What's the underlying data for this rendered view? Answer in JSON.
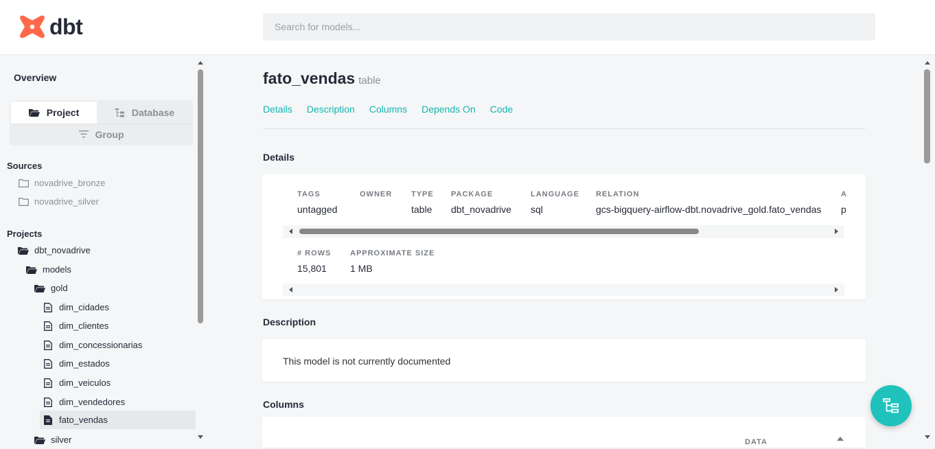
{
  "app": {
    "logo_text": "dbt",
    "brand_color": "#ff694a",
    "accent_color": "#13b5b0"
  },
  "search": {
    "placeholder": "Search for models..."
  },
  "sidebar": {
    "overview_label": "Overview",
    "toggle": {
      "project_label": "Project",
      "database_label": "Database",
      "group_label": "Group",
      "active": "Project"
    },
    "sources_title": "Sources",
    "sources": [
      "novadrive_bronze",
      "novadrive_silver"
    ],
    "projects_title": "Projects",
    "project_tree": {
      "project": "dbt_novadrive",
      "models_folder": "models",
      "gold_folder": "gold",
      "gold_models": [
        "dim_cidades",
        "dim_clientes",
        "dim_concessionarias",
        "dim_estados",
        "dim_veiculos",
        "dim_vendedores",
        "fato_vendas"
      ],
      "selected_model": "fato_vendas",
      "silver_folder": "silver"
    }
  },
  "model": {
    "name": "fato_vendas",
    "kind": "table",
    "tabs": [
      "Details",
      "Description",
      "Columns",
      "Depends On",
      "Code"
    ]
  },
  "details": {
    "section_title": "Details",
    "headers": {
      "tags": "Tags",
      "owner": "Owner",
      "type": "Type",
      "package": "Package",
      "language": "Language",
      "relation": "Relation",
      "truncated": "A"
    },
    "values": {
      "tags": "untagged",
      "owner": "",
      "type": "table",
      "package": "dbt_novadrive",
      "language": "sql",
      "relation": "gcs-bigquery-airflow-dbt.novadrive_gold.fato_vendas",
      "truncated": "p"
    },
    "stats_headers": {
      "rows": "# Rows",
      "size": "Approximate Size"
    },
    "stats_values": {
      "rows": "15,801",
      "size": "1 MB"
    }
  },
  "description": {
    "section_title": "Description",
    "text": "This model is not currently documented"
  },
  "columns": {
    "section_title": "Columns",
    "partial_header": "DATA"
  }
}
